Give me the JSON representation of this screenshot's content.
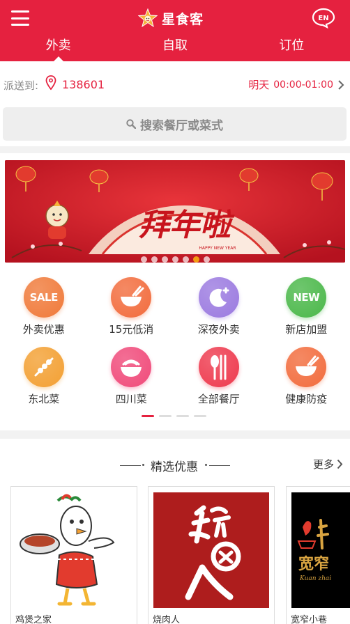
{
  "header": {
    "brand": "星食客",
    "lang": "EN",
    "tabs": [
      {
        "label": "外卖",
        "active": true
      },
      {
        "label": "自取",
        "active": false
      },
      {
        "label": "订位",
        "active": false
      }
    ]
  },
  "delivery": {
    "label": "派送到:",
    "address": "138601",
    "day": "明天",
    "time": "00:00-01:00"
  },
  "search": {
    "placeholder": "搜索餐厅或菜式"
  },
  "banner": {
    "headline": "拜年啦",
    "subtext": "HAPPY NEW YEAR",
    "dot_count": 7,
    "active_dot": 5
  },
  "categories": [
    {
      "label": "外卖优惠",
      "badge": "SALE",
      "icon": "sale-icon",
      "color": "#f07a3a"
    },
    {
      "label": "15元低消",
      "badge": "",
      "icon": "bowl-icon",
      "color": "#f26c3d"
    },
    {
      "label": "深夜外卖",
      "badge": "",
      "icon": "moon-icon",
      "color": "#9b7ae0"
    },
    {
      "label": "新店加盟",
      "badge": "NEW",
      "icon": "new-icon",
      "color": "#4bb84a"
    },
    {
      "label": "东北菜",
      "badge": "",
      "icon": "skewer-icon",
      "color": "#f3a033"
    },
    {
      "label": "四川菜",
      "badge": "",
      "icon": "noodle-icon",
      "color": "#f04a7a"
    },
    {
      "label": "全部餐厅",
      "badge": "",
      "icon": "cutlery-icon",
      "color": "#ee3a4e"
    },
    {
      "label": "健康防疫",
      "badge": "",
      "icon": "bowl-icon",
      "color": "#f26c3d"
    }
  ],
  "pager": {
    "count": 4,
    "active": 0
  },
  "featured": {
    "title": "精选优惠",
    "more": "更多",
    "restaurants": [
      {
        "name": "鸡煲之家",
        "logo": "chicken-logo"
      },
      {
        "name": "烧肉人",
        "logo": "shaorouren-logo"
      },
      {
        "name": "宽窄小巷",
        "logo": "kuanzhai-logo",
        "logo_text": "宽窄",
        "logo_sub": "Kuan zhai"
      }
    ]
  }
}
